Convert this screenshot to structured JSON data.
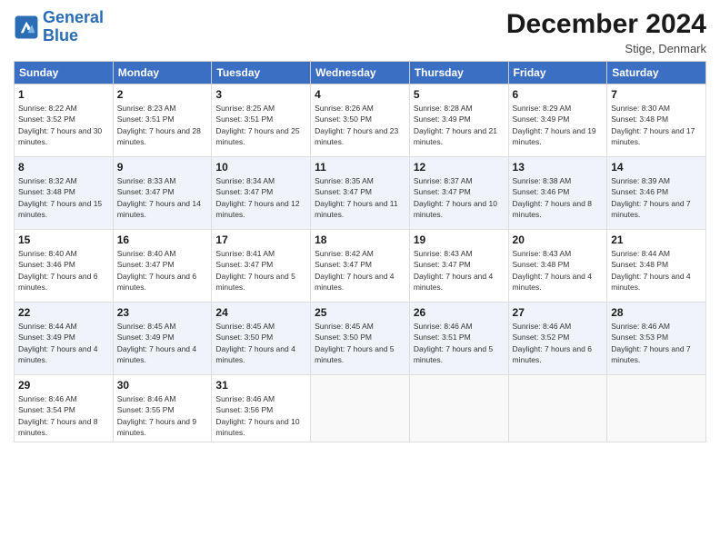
{
  "logo": {
    "line1": "General",
    "line2": "Blue"
  },
  "header": {
    "month": "December 2024",
    "location": "Stige, Denmark"
  },
  "weekdays": [
    "Sunday",
    "Monday",
    "Tuesday",
    "Wednesday",
    "Thursday",
    "Friday",
    "Saturday"
  ],
  "weeks": [
    [
      {
        "day": "1",
        "sunrise": "8:22 AM",
        "sunset": "3:52 PM",
        "daylight": "7 hours and 30 minutes."
      },
      {
        "day": "2",
        "sunrise": "8:23 AM",
        "sunset": "3:51 PM",
        "daylight": "7 hours and 28 minutes."
      },
      {
        "day": "3",
        "sunrise": "8:25 AM",
        "sunset": "3:51 PM",
        "daylight": "7 hours and 25 minutes."
      },
      {
        "day": "4",
        "sunrise": "8:26 AM",
        "sunset": "3:50 PM",
        "daylight": "7 hours and 23 minutes."
      },
      {
        "day": "5",
        "sunrise": "8:28 AM",
        "sunset": "3:49 PM",
        "daylight": "7 hours and 21 minutes."
      },
      {
        "day": "6",
        "sunrise": "8:29 AM",
        "sunset": "3:49 PM",
        "daylight": "7 hours and 19 minutes."
      },
      {
        "day": "7",
        "sunrise": "8:30 AM",
        "sunset": "3:48 PM",
        "daylight": "7 hours and 17 minutes."
      }
    ],
    [
      {
        "day": "8",
        "sunrise": "8:32 AM",
        "sunset": "3:48 PM",
        "daylight": "7 hours and 15 minutes."
      },
      {
        "day": "9",
        "sunrise": "8:33 AM",
        "sunset": "3:47 PM",
        "daylight": "7 hours and 14 minutes."
      },
      {
        "day": "10",
        "sunrise": "8:34 AM",
        "sunset": "3:47 PM",
        "daylight": "7 hours and 12 minutes."
      },
      {
        "day": "11",
        "sunrise": "8:35 AM",
        "sunset": "3:47 PM",
        "daylight": "7 hours and 11 minutes."
      },
      {
        "day": "12",
        "sunrise": "8:37 AM",
        "sunset": "3:47 PM",
        "daylight": "7 hours and 10 minutes."
      },
      {
        "day": "13",
        "sunrise": "8:38 AM",
        "sunset": "3:46 PM",
        "daylight": "7 hours and 8 minutes."
      },
      {
        "day": "14",
        "sunrise": "8:39 AM",
        "sunset": "3:46 PM",
        "daylight": "7 hours and 7 minutes."
      }
    ],
    [
      {
        "day": "15",
        "sunrise": "8:40 AM",
        "sunset": "3:46 PM",
        "daylight": "7 hours and 6 minutes."
      },
      {
        "day": "16",
        "sunrise": "8:40 AM",
        "sunset": "3:47 PM",
        "daylight": "7 hours and 6 minutes."
      },
      {
        "day": "17",
        "sunrise": "8:41 AM",
        "sunset": "3:47 PM",
        "daylight": "7 hours and 5 minutes."
      },
      {
        "day": "18",
        "sunrise": "8:42 AM",
        "sunset": "3:47 PM",
        "daylight": "7 hours and 4 minutes."
      },
      {
        "day": "19",
        "sunrise": "8:43 AM",
        "sunset": "3:47 PM",
        "daylight": "7 hours and 4 minutes."
      },
      {
        "day": "20",
        "sunrise": "8:43 AM",
        "sunset": "3:48 PM",
        "daylight": "7 hours and 4 minutes."
      },
      {
        "day": "21",
        "sunrise": "8:44 AM",
        "sunset": "3:48 PM",
        "daylight": "7 hours and 4 minutes."
      }
    ],
    [
      {
        "day": "22",
        "sunrise": "8:44 AM",
        "sunset": "3:49 PM",
        "daylight": "7 hours and 4 minutes."
      },
      {
        "day": "23",
        "sunrise": "8:45 AM",
        "sunset": "3:49 PM",
        "daylight": "7 hours and 4 minutes."
      },
      {
        "day": "24",
        "sunrise": "8:45 AM",
        "sunset": "3:50 PM",
        "daylight": "7 hours and 4 minutes."
      },
      {
        "day": "25",
        "sunrise": "8:45 AM",
        "sunset": "3:50 PM",
        "daylight": "7 hours and 5 minutes."
      },
      {
        "day": "26",
        "sunrise": "8:46 AM",
        "sunset": "3:51 PM",
        "daylight": "7 hours and 5 minutes."
      },
      {
        "day": "27",
        "sunrise": "8:46 AM",
        "sunset": "3:52 PM",
        "daylight": "7 hours and 6 minutes."
      },
      {
        "day": "28",
        "sunrise": "8:46 AM",
        "sunset": "3:53 PM",
        "daylight": "7 hours and 7 minutes."
      }
    ],
    [
      {
        "day": "29",
        "sunrise": "8:46 AM",
        "sunset": "3:54 PM",
        "daylight": "7 hours and 8 minutes."
      },
      {
        "day": "30",
        "sunrise": "8:46 AM",
        "sunset": "3:55 PM",
        "daylight": "7 hours and 9 minutes."
      },
      {
        "day": "31",
        "sunrise": "8:46 AM",
        "sunset": "3:56 PM",
        "daylight": "7 hours and 10 minutes."
      },
      null,
      null,
      null,
      null
    ]
  ]
}
